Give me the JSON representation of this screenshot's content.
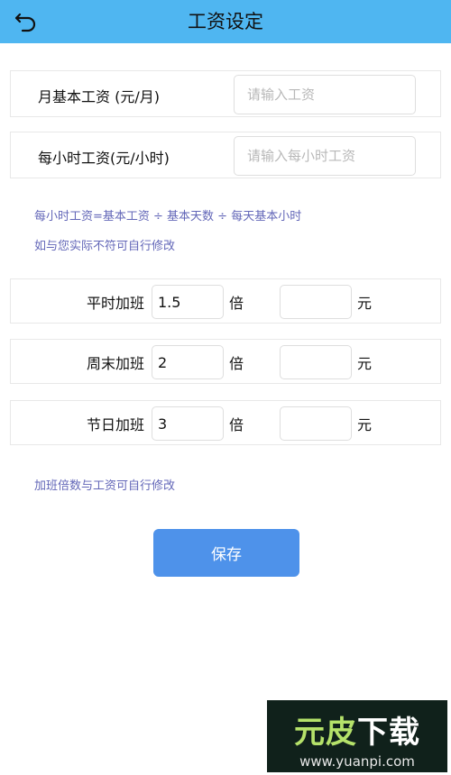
{
  "header": {
    "title": "工资设定",
    "back_icon": "undo-arrow-icon",
    "bg_color": "#4fb6f1"
  },
  "base_salary": {
    "monthly_label": "月基本工资  (元/月)",
    "monthly_placeholder": "请输入工资",
    "hourly_label": "每小时工资(元/小时)",
    "hourly_placeholder": "请输入每小时工资"
  },
  "notes": {
    "formula": "每小时工资=基本工资 ÷ 基本天数 ÷ 每天基本小时",
    "modify": "如与您实际不符可自行修改",
    "overtime": "加班倍数与工资可自行修改",
    "color": "#6367b8"
  },
  "overtime": [
    {
      "label": "平时加班",
      "multiplier": "1.5",
      "times_unit": "倍",
      "amount": "",
      "currency_unit": "元"
    },
    {
      "label": "周末加班",
      "multiplier": "2",
      "times_unit": "倍",
      "amount": "",
      "currency_unit": "元"
    },
    {
      "label": "节日加班",
      "multiplier": "3",
      "times_unit": "倍",
      "amount": "",
      "currency_unit": "元"
    }
  ],
  "save_button": {
    "label": "保存",
    "color": "#4e92ea"
  },
  "watermark": {
    "logo_text": "元皮下载",
    "url": "www.yuanpi.com"
  }
}
